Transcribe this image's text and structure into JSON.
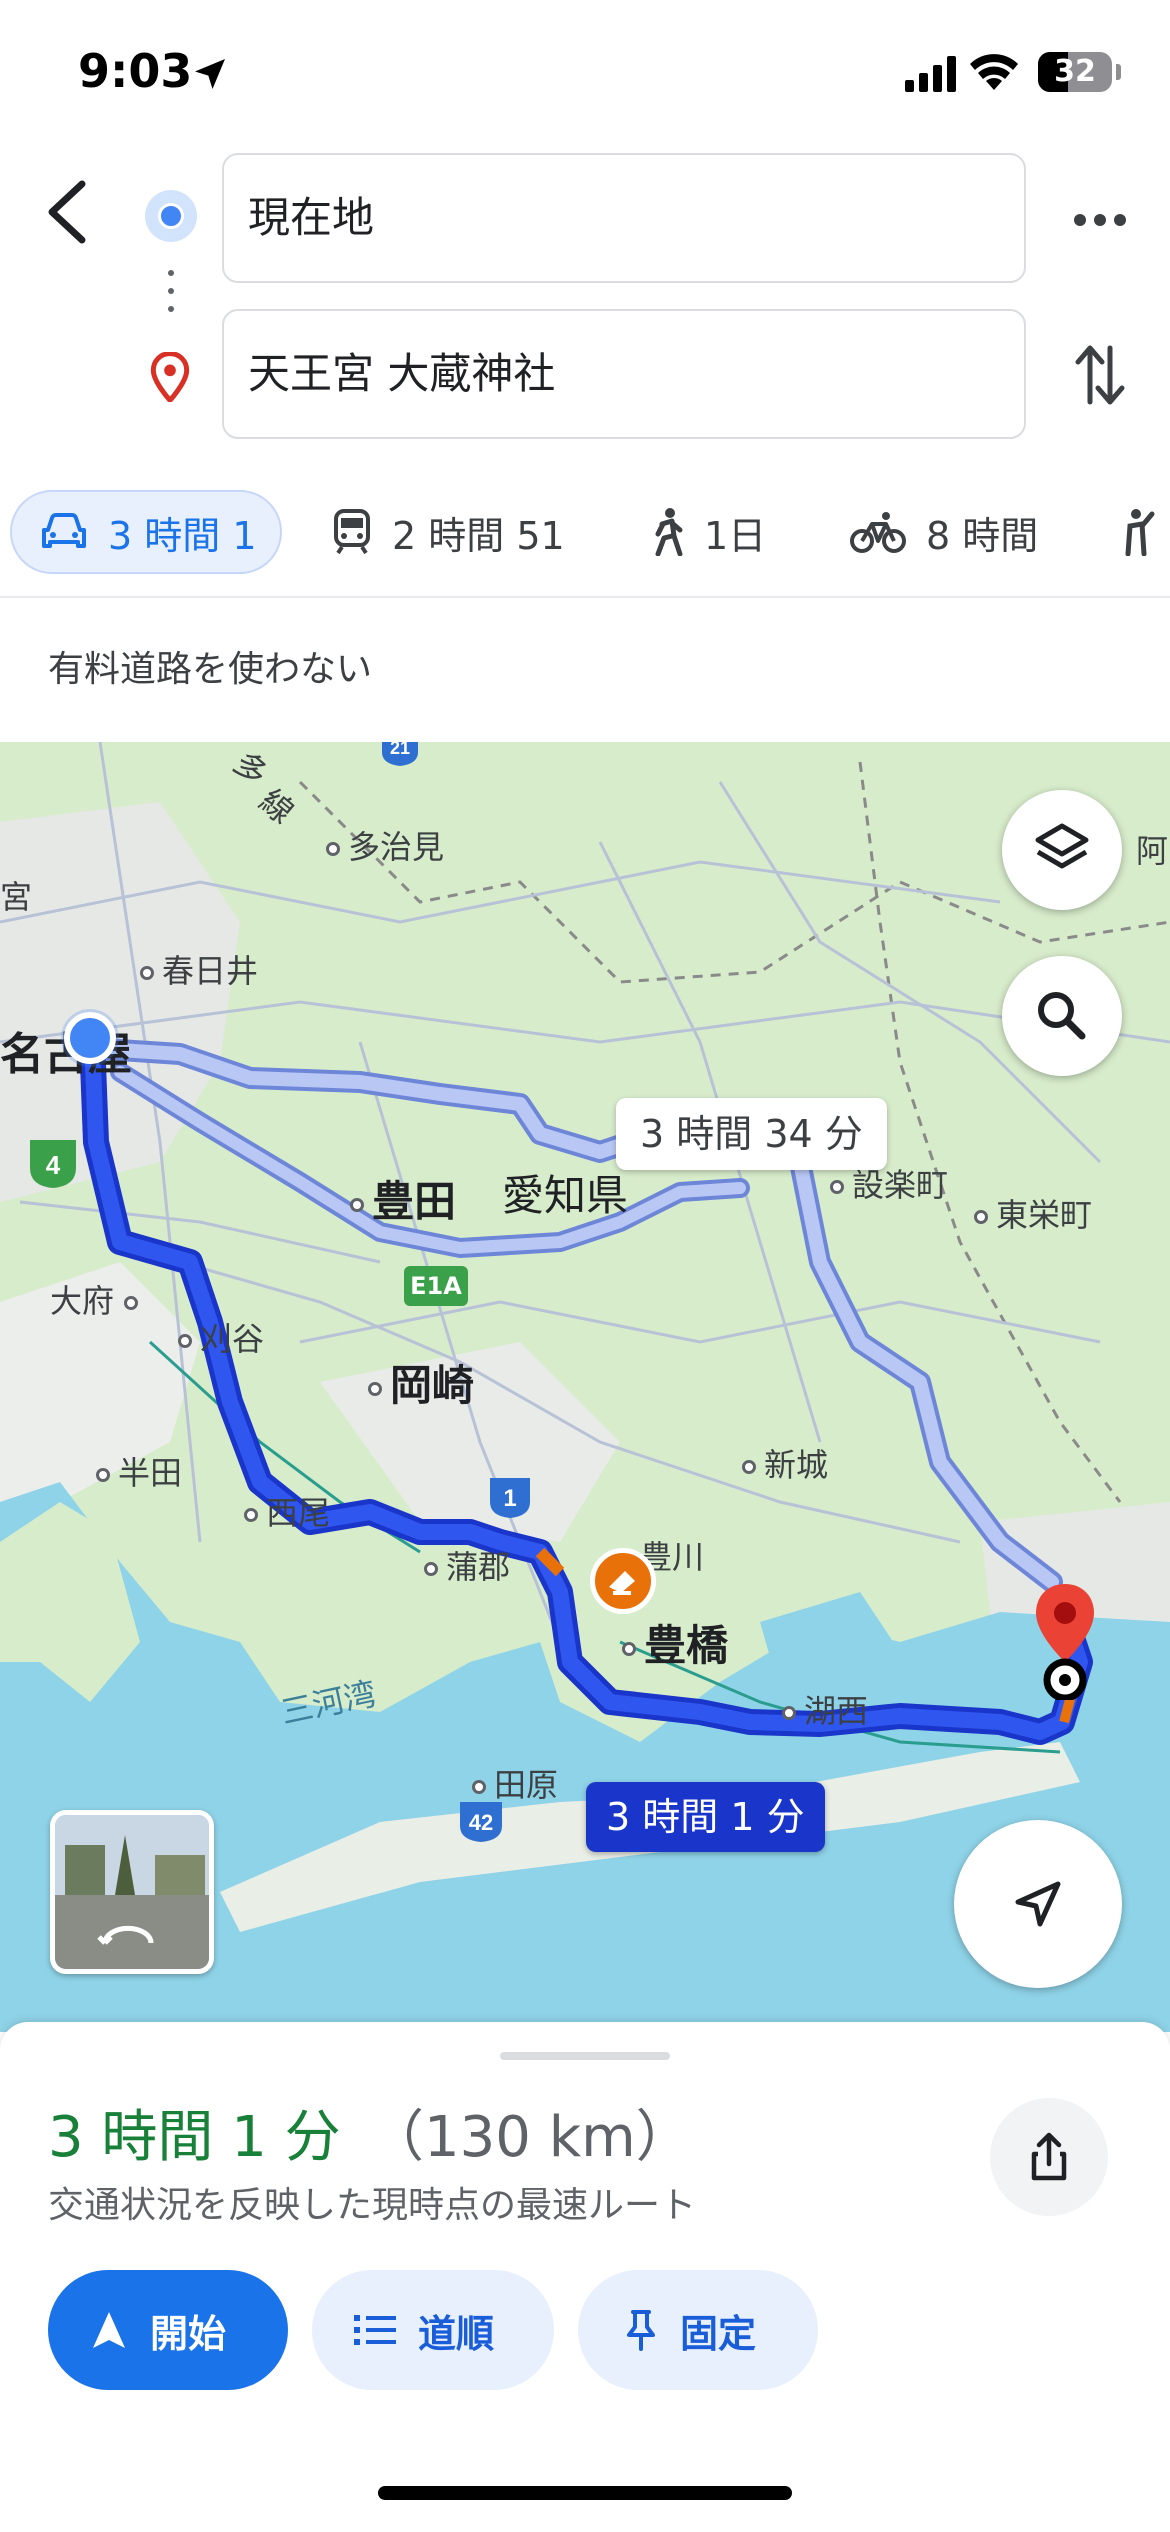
{
  "status_bar": {
    "time": "9:03",
    "battery": "32"
  },
  "directions": {
    "origin": "現在地",
    "destination": "天王宮 大蔵神社"
  },
  "travel_modes": [
    {
      "mode": "car",
      "label": "3 時間 1",
      "selected": true
    },
    {
      "mode": "transit",
      "label": "2 時間 51",
      "selected": false
    },
    {
      "mode": "walk",
      "label": "1日",
      "selected": false
    },
    {
      "mode": "bicycle",
      "label": "8 時間",
      "selected": false
    }
  ],
  "route_option": "有料道路を使わない",
  "map": {
    "places": [
      "多治見",
      "春日井",
      "名古屋",
      "豊田",
      "愛知県",
      "設楽町",
      "東栄町",
      "大府",
      "刈谷",
      "岡崎",
      "半田",
      "西尾",
      "蒲郡",
      "新城",
      "豊川",
      "豊橋",
      "湖西",
      "田原",
      "三河湾",
      "阿",
      "宮",
      "多",
      "線"
    ],
    "highways": [
      "4",
      "E1A",
      "1",
      "42",
      "21"
    ],
    "alt_route_label": "3 時間 34 分",
    "main_route_label": "3 時間 1 分",
    "colors": {
      "route_main": "#1a35c9",
      "route_alt": "#a8b8f0",
      "water": "#8fd3e8",
      "land": "#d7eccb"
    }
  },
  "summary": {
    "duration": "3 時間 1 分",
    "distance": "（130 km）",
    "description": "交通状況を反映した現時点の最速ルート"
  },
  "actions": {
    "start": "開始",
    "steps": "道順",
    "pin": "固定"
  }
}
